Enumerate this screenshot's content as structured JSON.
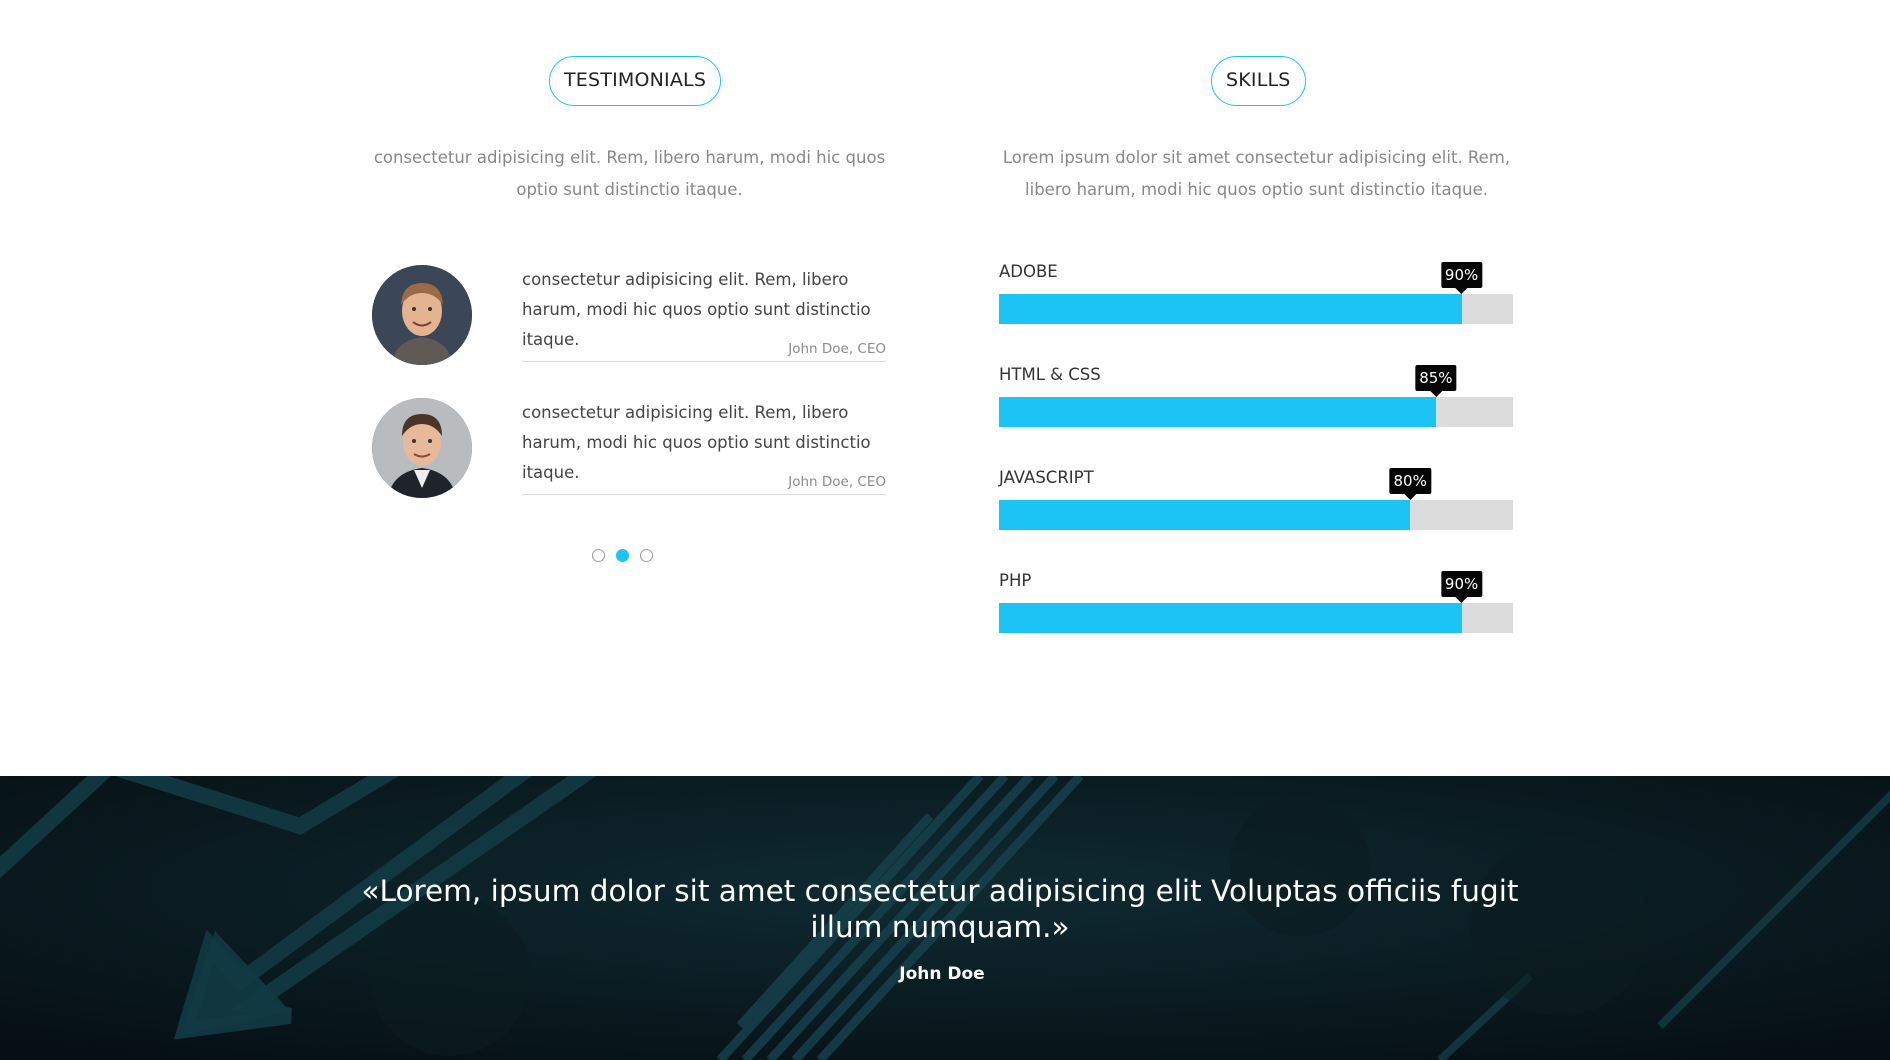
{
  "testimonials": {
    "heading": "TESTIMONIALS",
    "intro": "consectetur adipisicing elit. Rem, libero harum, modi hic quos optio sunt distinctio itaque.",
    "items": [
      {
        "text": "consectetur adipisicing elit. Rem, libero harum, modi hic quos optio sunt distinctio itaque.",
        "author": "John Doe, CEO"
      },
      {
        "text": "consectetur adipisicing elit. Rem, libero harum, modi hic quos optio sunt distinctio itaque.",
        "author": "John Doe, CEO"
      }
    ],
    "active_page": 2,
    "page_count": 3
  },
  "skills": {
    "heading": "SKILLS",
    "intro": "Lorem ipsum dolor sit amet consectetur adipisicing elit. Rem, libero harum, modi hic quos optio sunt distinctio itaque.",
    "items": [
      {
        "name": "ADOBE",
        "percent": 90,
        "label": "90%"
      },
      {
        "name": "HTML & CSS",
        "percent": 85,
        "label": "85%"
      },
      {
        "name": "JAVASCRIPT",
        "percent": 80,
        "label": "80%"
      },
      {
        "name": "PHP",
        "percent": 90,
        "label": "90%"
      }
    ]
  },
  "banner": {
    "quote": "«Lorem, ipsum dolor sit amet consectetur adipisicing elit Voluptas officiis fugit illum numquam.»",
    "author": "John Doe"
  },
  "colors": {
    "accent": "#1cc3f5",
    "track": "#dcdcdc",
    "banner_bg": "#071318"
  }
}
